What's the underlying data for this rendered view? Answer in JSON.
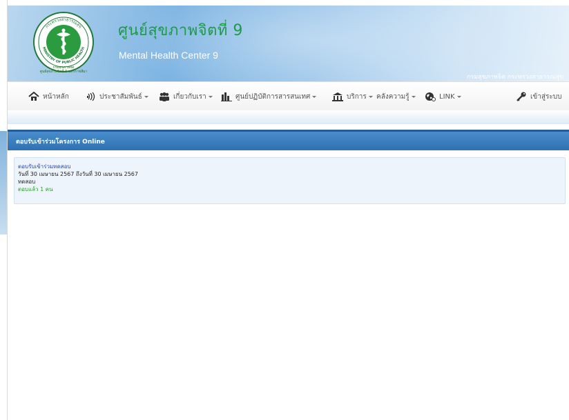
{
  "header": {
    "title_th": "ศูนย์สุขภาพจิตที่ 9",
    "title_en": "Mental Health Center 9",
    "department": "กรมสุขภาพจิต กระทรวงสาธารณสุข",
    "logo_ring_top": "กระทรวงสาธารณสุข",
    "logo_ring_bottom": "MINISTRY OF PUBLIC HEALTH",
    "logo_caption_1": "กรมสุขภาพจิต",
    "logo_caption_2": "ศูนย์สุขภาพจิตที่ 9 นครราชสีมา"
  },
  "nav": {
    "home": "หน้าหลัก",
    "pr": "ประชาสัมพันธ์",
    "about": "เกี่ยวกับเรา",
    "info_center": "ศูนย์ปฏิบัติการสารสนเทศ",
    "services": "บริการ",
    "knowledge": "คลังความรู้",
    "link": "LINK",
    "login": "เข้าสู่ระบบ"
  },
  "panel": {
    "heading": "ตอบรับเข้าร่วมโครงการ Online"
  },
  "items": [
    {
      "title": "ตอบรับเข้าร่วมทดสอบ",
      "date": "วันที่ 30 เมษายน 2567 ถึงวันที่ 30 เมษายน 2567",
      "description": "ทดสอบ",
      "responses": "ตอบแล้ว 1 คน"
    }
  ],
  "icons": [
    "home-icon",
    "megaphone-icon",
    "people-icon",
    "bar-chart-icon",
    "building-icon",
    "globe-icon",
    "key-icon"
  ],
  "colors": {
    "title_green": "#1e9a4a",
    "panel_blue": "#2f72b4",
    "link_blue": "#2345b5",
    "response_green": "#2aa02a"
  }
}
